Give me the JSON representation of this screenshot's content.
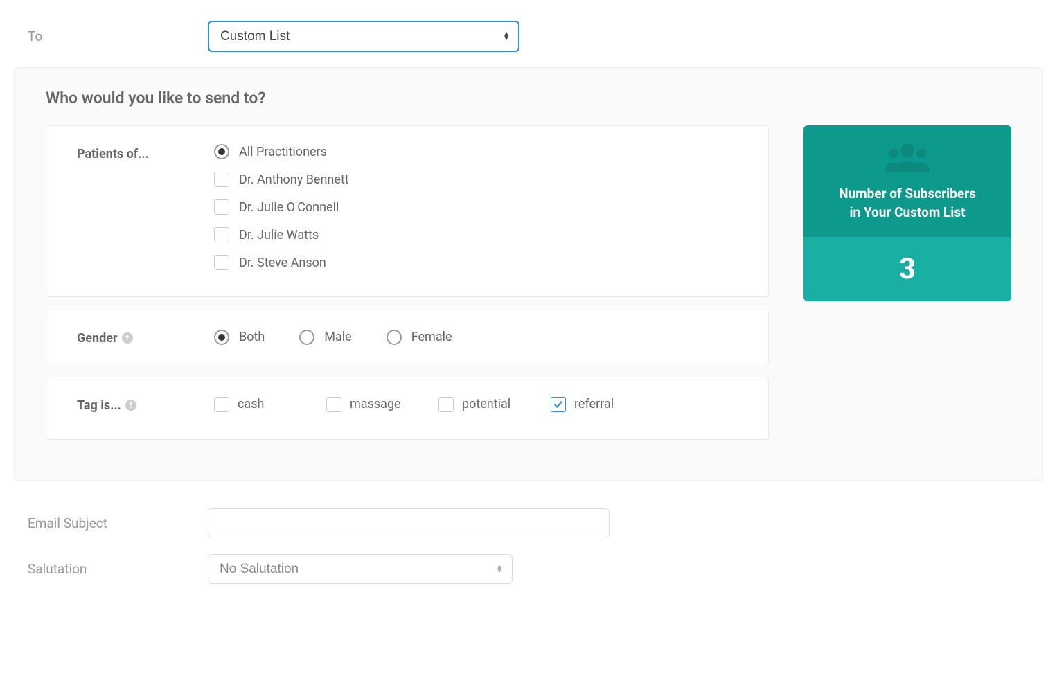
{
  "to": {
    "label": "To",
    "selected": "Custom List"
  },
  "panel": {
    "title": "Who would you like to send to?"
  },
  "patients": {
    "label": "Patients of...",
    "options": [
      {
        "label": "All Practitioners",
        "type": "radio",
        "selected": true
      },
      {
        "label": "Dr. Anthony Bennett",
        "type": "checkbox",
        "selected": false
      },
      {
        "label": "Dr. Julie O'Connell",
        "type": "checkbox",
        "selected": false
      },
      {
        "label": "Dr. Julie Watts",
        "type": "checkbox",
        "selected": false
      },
      {
        "label": "Dr. Steve Anson",
        "type": "checkbox",
        "selected": false
      }
    ]
  },
  "gender": {
    "label": "Gender",
    "options": [
      {
        "label": "Both",
        "selected": true
      },
      {
        "label": "Male",
        "selected": false
      },
      {
        "label": "Female",
        "selected": false
      }
    ]
  },
  "tags": {
    "label": "Tag is...",
    "options": [
      {
        "label": "cash",
        "selected": false
      },
      {
        "label": "massage",
        "selected": false
      },
      {
        "label": "potential",
        "selected": false
      },
      {
        "label": "referral",
        "selected": true
      }
    ]
  },
  "subscribers": {
    "title_line1": "Number of Subscribers",
    "title_line2": "in Your Custom List",
    "count": "3"
  },
  "subject": {
    "label": "Email Subject",
    "value": ""
  },
  "salutation": {
    "label": "Salutation",
    "selected": "No Salutation"
  }
}
